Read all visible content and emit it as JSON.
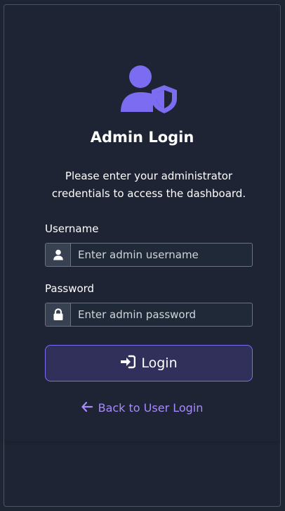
{
  "app": {
    "title": "Admin Login",
    "subtitle": "Please enter your administrator credentials to access the dashboard."
  },
  "form": {
    "username": {
      "label": "Username",
      "placeholder": "Enter admin username",
      "value": ""
    },
    "password": {
      "label": "Password",
      "placeholder": "Enter admin password",
      "value": ""
    }
  },
  "actions": {
    "login_label": "Login",
    "back_label": "Back to User Login"
  },
  "icons": {
    "header": "user-shield-icon",
    "username_addon": "user-icon",
    "password_addon": "lock-icon",
    "login_icon": "sign-in-icon",
    "back_icon": "arrow-left-icon"
  },
  "colors": {
    "background": "#1e2433",
    "accent": "#7c6cf2",
    "link": "#a78bfa",
    "button_bg": "#30305a",
    "input_border": "#6b7280"
  }
}
